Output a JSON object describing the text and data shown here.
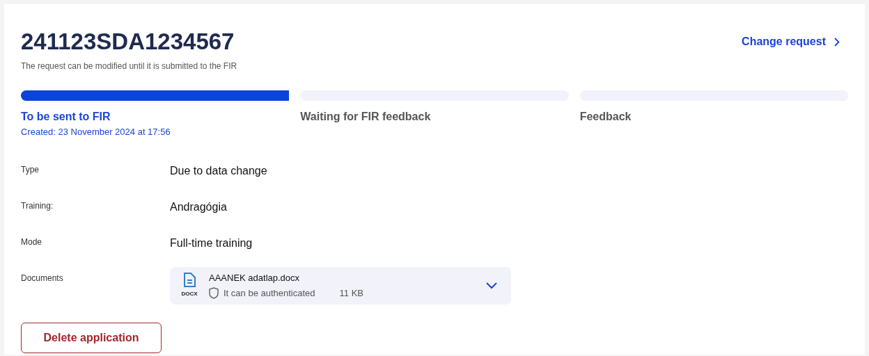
{
  "header": {
    "title": "241123SDA1234567",
    "subtitle": "The request can be modified until it is submitted to the FIR",
    "action": "Change request"
  },
  "steps": [
    {
      "label": "To be sent to FIR",
      "detail": "Created: 23 November 2024 at 17:56",
      "selected": true
    },
    {
      "label": "Waiting for FIR feedback",
      "selected": false
    },
    {
      "label": "Feedback",
      "selected": false
    }
  ],
  "fields": [
    {
      "label": "Type",
      "value": "Due to data change",
      "kind": "text"
    },
    {
      "label": "Training:",
      "value": "Andragógia",
      "kind": "text"
    },
    {
      "label": "Mode",
      "value": "Full-time training",
      "kind": "text"
    },
    {
      "label": "Documents",
      "kind": "documents",
      "documents": [
        {
          "file_type": "DOCX",
          "name": "AAANEK adatlap.docx",
          "status": "It can be authenticated",
          "size": "11 KB",
          "expanded": false
        }
      ]
    }
  ],
  "delete_button": "Delete application"
}
